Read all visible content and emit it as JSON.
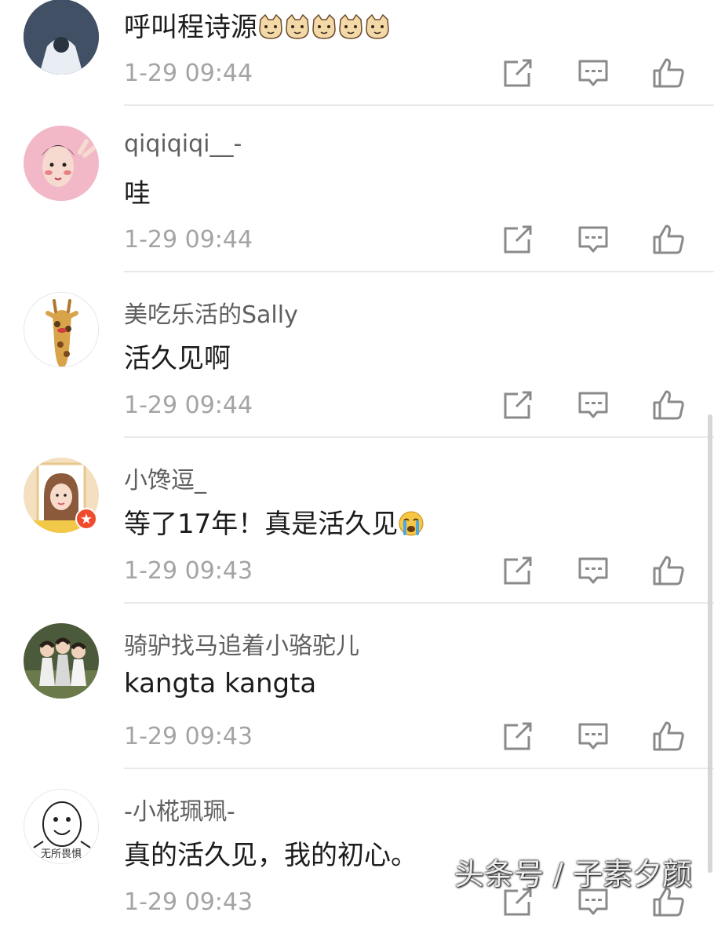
{
  "comments": [
    {
      "username": "",
      "text": "呼叫程诗源",
      "emojis": [
        "cat-face-icon",
        "cat-face-icon",
        "cat-face-icon",
        "cat-face-icon",
        "cat-face-icon"
      ],
      "time": "1-29 09:44"
    },
    {
      "username": "qiqiqiqi__-",
      "text": "哇",
      "time": "1-29 09:44"
    },
    {
      "username": "美吃乐活的Sally",
      "text": "活久见啊",
      "time": "1-29 09:44"
    },
    {
      "username": "小馋逗_",
      "text": "等了17年！真是活久见",
      "emojis": [
        "crying-face-icon"
      ],
      "time": "1-29 09:43",
      "verified": true
    },
    {
      "username": "骑驴找马追着小骆驼儿",
      "text": "kangta kangta",
      "time": "1-29 09:43"
    },
    {
      "username": "-小椛珮珮-",
      "text": "真的活久见，我的初心。",
      "time": "1-29 09:43"
    }
  ],
  "avatar_caption": "无所畏惧",
  "actions": [
    "share-icon",
    "reply-icon",
    "like-icon"
  ],
  "watermark": "头条号 / 子素夕颜",
  "colors": {
    "username": "#5f5f5f",
    "text": "#1c1c1c",
    "time": "#a4a4a4",
    "divider": "#e9e9e9",
    "icon": "#8a8a8a",
    "badge": "#f04b2c"
  }
}
